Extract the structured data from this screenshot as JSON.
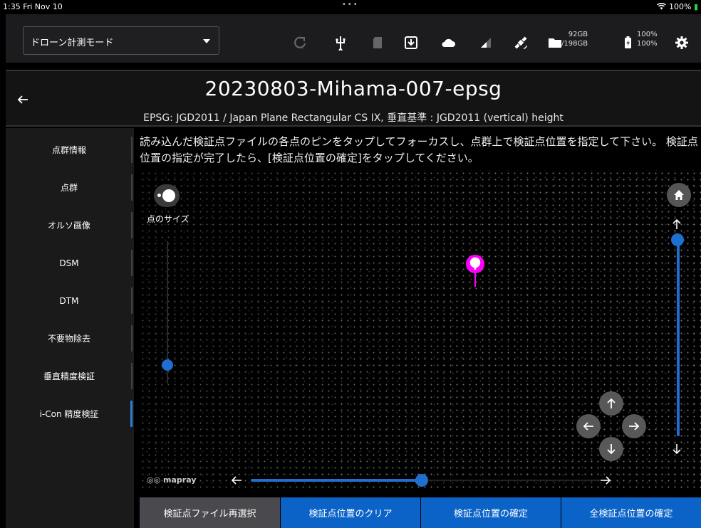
{
  "status_bar": {
    "time": "1:35",
    "date": "Fri Nov 10",
    "battery": "100%"
  },
  "toolbar": {
    "mode": "ドローン計測モード",
    "storage_used": "92GB",
    "storage_total": "/198GB",
    "battery_1": "100%",
    "battery_2": "100%"
  },
  "header": {
    "title": "20230803-Mihama-007-epsg",
    "subtitle": "EPSG: JGD2011 / Japan Plane Rectangular CS IX, 垂直基準 : JGD2011 (vertical) height"
  },
  "sidebar": {
    "items": [
      {
        "label": "点群情報"
      },
      {
        "label": "点群"
      },
      {
        "label": "オルソ画像"
      },
      {
        "label": "DSM"
      },
      {
        "label": "DTM"
      },
      {
        "label": "不要物除去"
      },
      {
        "label": "垂直精度検証"
      },
      {
        "label": "i-Con 精度検証"
      }
    ],
    "active_index": 7
  },
  "instruction": "読み込んだ検証点ファイルの各点のピンをタップしてフォーカスし、点群上で検証点位置を指定して下さい。 検証点位置の指定が完了したら、[検証点位置の確定]をタップしてください。",
  "map": {
    "point_size_label": "点のサイズ",
    "point_size_level": 0.05,
    "vertical_scroll_position": 0.0,
    "horizontal_scroll_position": 0.5,
    "logo": "mapray",
    "pin_color": "#ff00ff"
  },
  "bottom_buttons": {
    "reselect": "検証点ファイル再選択",
    "clear": "検証点位置のクリア",
    "confirm": "検証点位置の確定",
    "confirm_all": "全検証点位置の確定"
  },
  "colors": {
    "accent": "#1f6fd0",
    "button_blue": "#0b63c8",
    "pin": "#ff00ff"
  }
}
